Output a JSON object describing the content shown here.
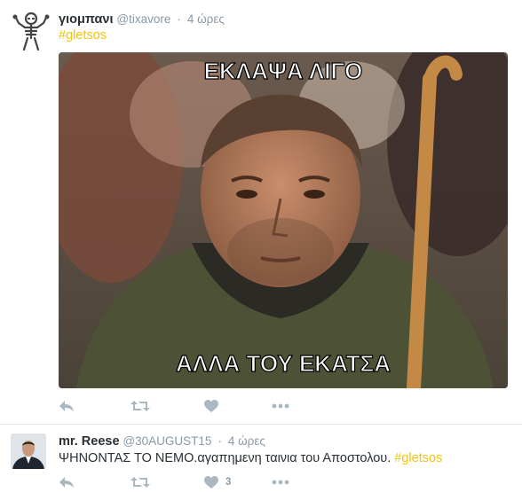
{
  "tweets": [
    {
      "fullname": "γιομπανι",
      "username": "@tixavore",
      "time": "4 ώρες",
      "hashtag": "#gletsos",
      "text_before": "",
      "text_after": "",
      "media": {
        "caption_top": "ΕΚΛΑΨΑ ΛΙΓΟ",
        "caption_bottom": "ΑΛΛΑ ΤΟΥ ΕΚΑΤΣΑ"
      },
      "actions": {
        "like_count": ""
      }
    },
    {
      "fullname": "mr. Reese",
      "username": "@30AUGUST15",
      "time": "4 ώρες",
      "hashtag": "#gletsos",
      "text_before": "ΨΗΝΟΝΤΑΣ ΤΟ ΝΕΜΟ.αγαπημενη ταινια του Αποστολου. ",
      "text_after": "",
      "actions": {
        "like_count": "3"
      }
    }
  ],
  "colors": {
    "hashtag": "#f1c40f",
    "action_icon": "#aab8c2",
    "meta_text": "#8899a6"
  },
  "icons": [
    "reply-icon",
    "retweet-icon",
    "like-icon",
    "more-icon"
  ]
}
